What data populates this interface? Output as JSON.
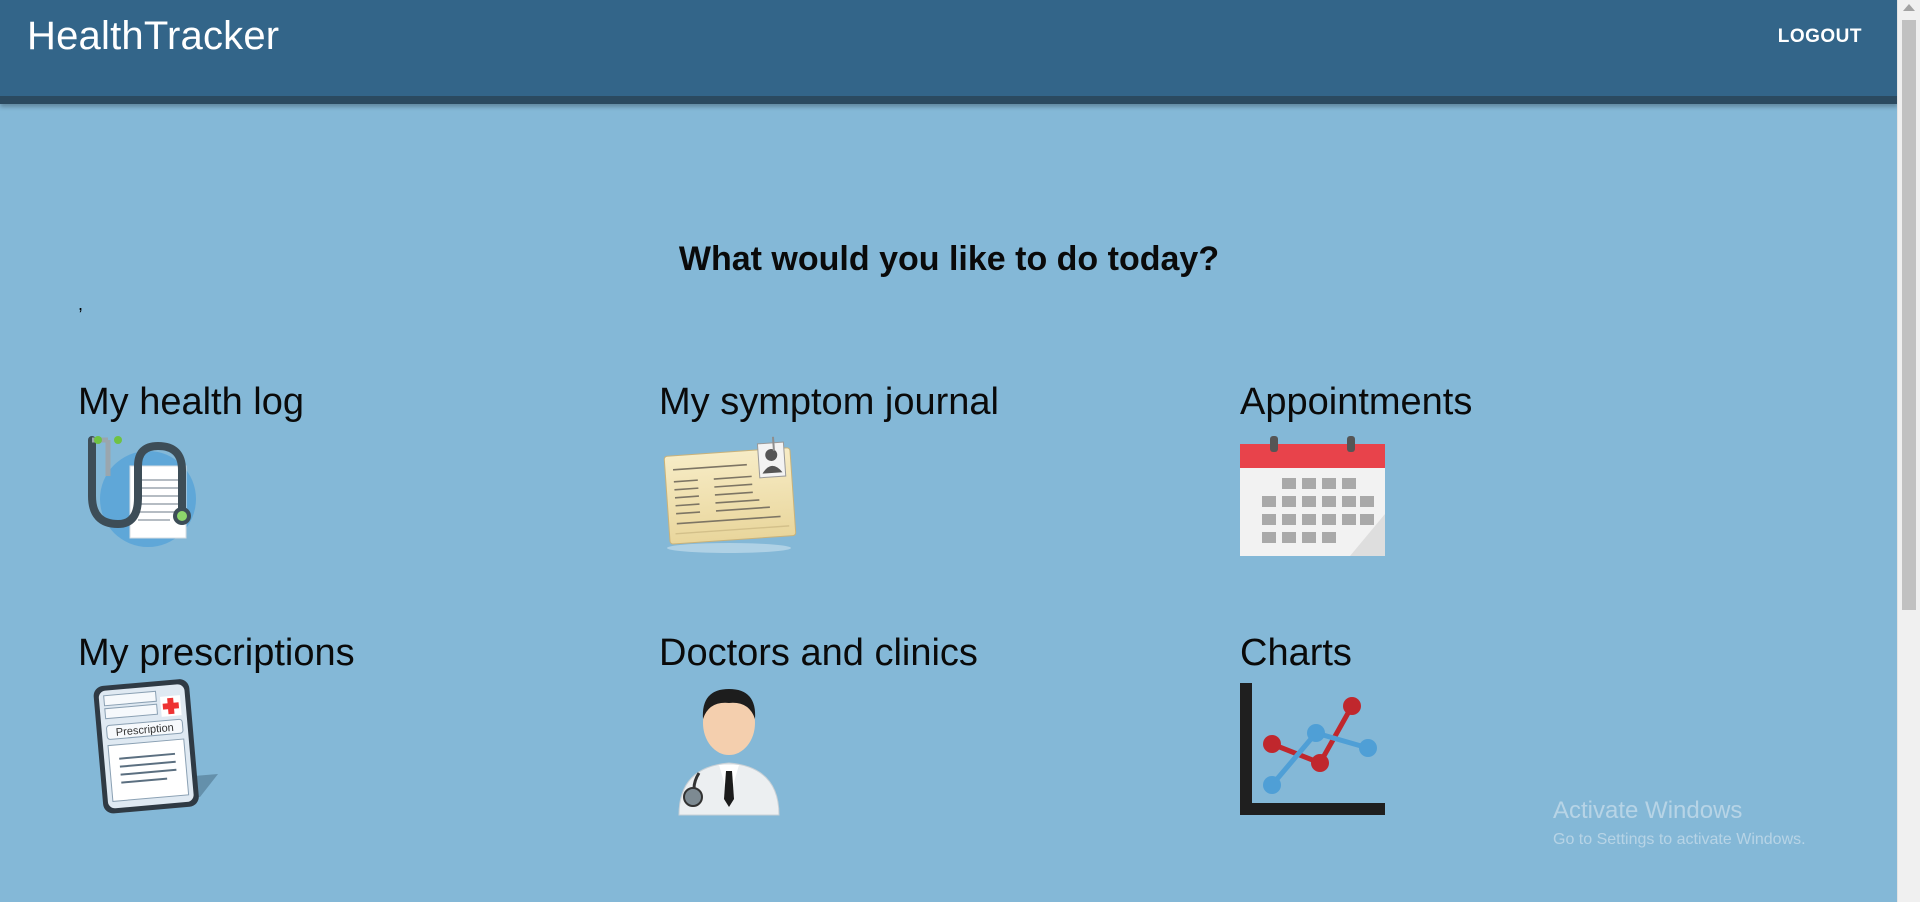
{
  "header": {
    "brand": "HealthTracker",
    "logout_label": "LOGOUT"
  },
  "main": {
    "headline": "What would you like to do today?",
    "stray_text": ",",
    "tiles": [
      {
        "label": "My health log",
        "icon": "stethoscope-document-icon"
      },
      {
        "label": "My symptom journal",
        "icon": "id-card-icon"
      },
      {
        "label": "Appointments",
        "icon": "calendar-icon"
      },
      {
        "label": "My prescriptions",
        "icon": "prescription-clipboard-icon"
      },
      {
        "label": "Doctors and clinics",
        "icon": "doctor-icon"
      },
      {
        "label": "Charts",
        "icon": "line-chart-icon"
      }
    ]
  },
  "watermark": {
    "title": "Activate Windows",
    "subtitle": "Go to Settings to activate Windows."
  },
  "colors": {
    "background": "#84b8d7",
    "header": "#336589",
    "calendar_red": "#e8434b"
  }
}
